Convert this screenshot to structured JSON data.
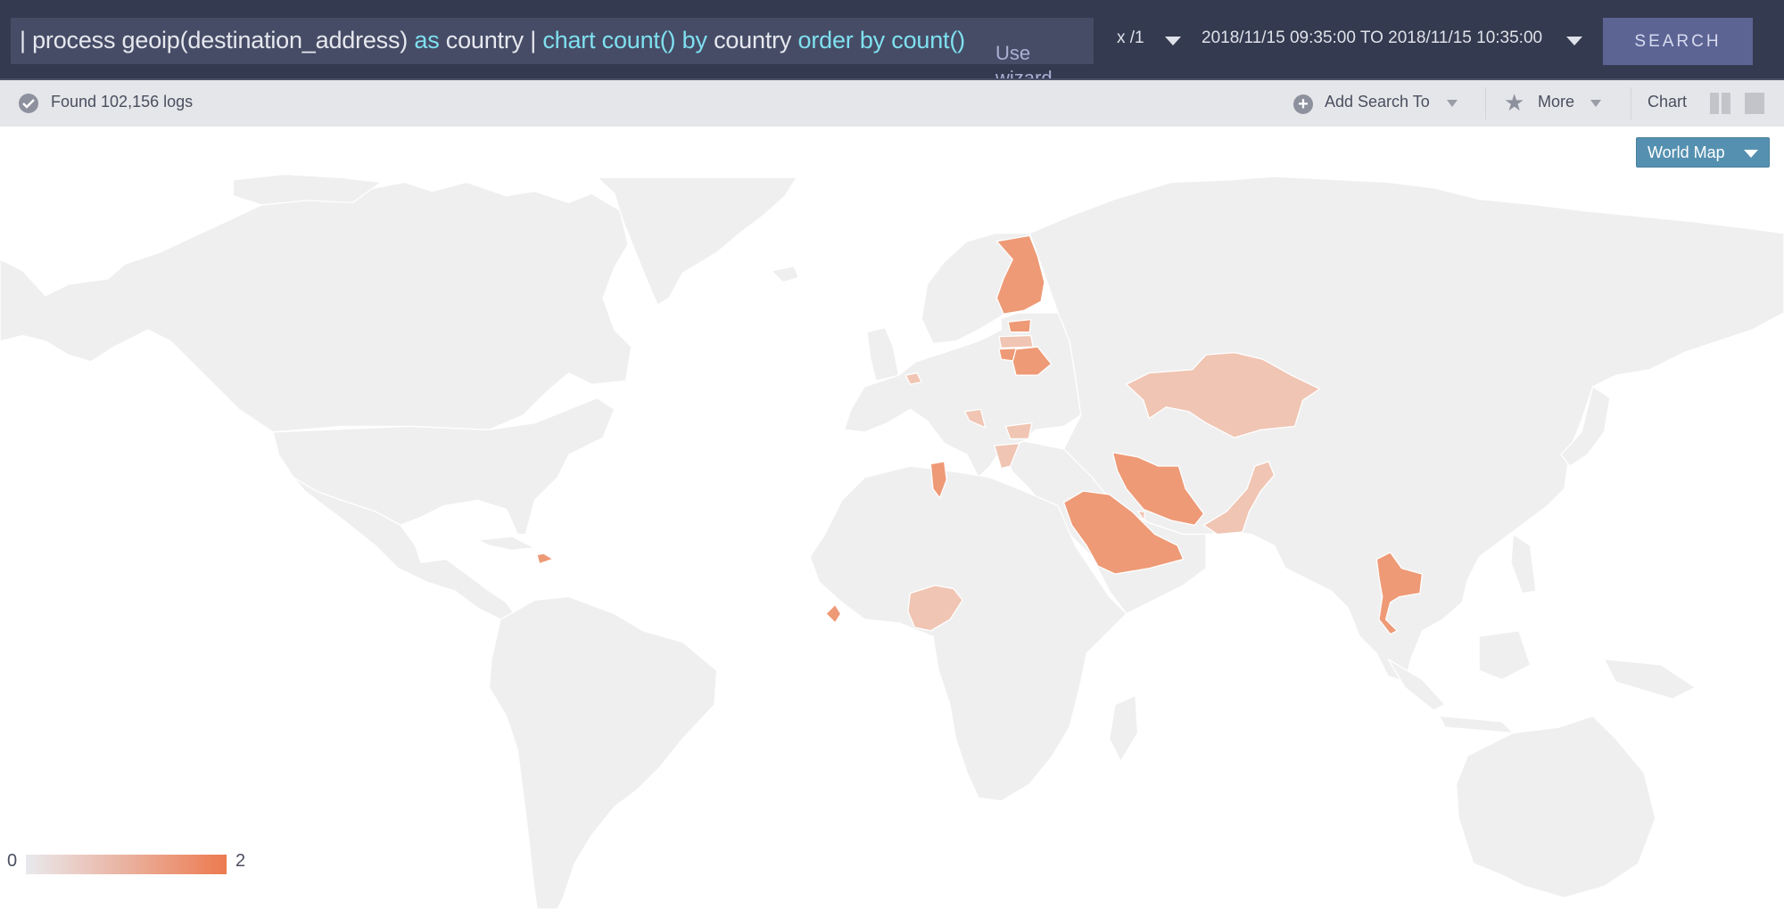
{
  "topbar": {
    "query": {
      "segments": [
        {
          "text": "| process geoip(destination_address) ",
          "type": "plain"
        },
        {
          "text": "as",
          "type": "keyword"
        },
        {
          "text": " country | ",
          "type": "plain"
        },
        {
          "text": "chart count()",
          "type": "keyword"
        },
        {
          "text": " ",
          "type": "plain"
        },
        {
          "text": "by",
          "type": "keyword"
        },
        {
          "text": " country ",
          "type": "plain"
        },
        {
          "text": "order by count()",
          "type": "keyword"
        }
      ]
    },
    "wizard_label": "Use wizard",
    "scale_label": "x /1",
    "time_range": "2018/11/15 09:35:00 TO 2018/11/15 10:35:00",
    "search_label": "SEARCH"
  },
  "statusbar": {
    "found_text": "Found 102,156 logs",
    "add_search_label": "Add Search To",
    "more_label": "More",
    "chart_label": "Chart"
  },
  "map": {
    "view_label": "World Map",
    "colors": {
      "land": "#efefef",
      "border": "#ffffff",
      "scale_low": "#e9e9ee",
      "scale_high": "#ec7a4f",
      "value_1": "#f0c5b3",
      "value_2": "#ee9a76"
    },
    "legend": {
      "min": "0",
      "max": "2"
    }
  },
  "chart_data": {
    "type": "heatmap",
    "subtype": "choropleth",
    "title": "World Map",
    "metric": "count()",
    "group_by": "country",
    "scale": {
      "min": 0,
      "max": 2
    },
    "legend_position": "bottom-left",
    "countries": [
      {
        "name": "Finland",
        "value": 2
      },
      {
        "name": "Estonia",
        "value": 2
      },
      {
        "name": "Lithuania",
        "value": 2
      },
      {
        "name": "Belarus",
        "value": 2
      },
      {
        "name": "Tunisia",
        "value": 2
      },
      {
        "name": "Iran",
        "value": 2
      },
      {
        "name": "Saudi Arabia",
        "value": 2
      },
      {
        "name": "Thailand",
        "value": 2
      },
      {
        "name": "Sierra Leone",
        "value": 2
      },
      {
        "name": "Dominican Republic",
        "value": 2
      },
      {
        "name": "Latvia",
        "value": 1
      },
      {
        "name": "Belgium",
        "value": 1
      },
      {
        "name": "Croatia",
        "value": 1
      },
      {
        "name": "Bulgaria",
        "value": 1
      },
      {
        "name": "Greece",
        "value": 1
      },
      {
        "name": "Kuwait",
        "value": 1
      },
      {
        "name": "Kazakhstan",
        "value": 1
      },
      {
        "name": "Pakistan",
        "value": 1
      },
      {
        "name": "Nigeria",
        "value": 1
      }
    ]
  }
}
